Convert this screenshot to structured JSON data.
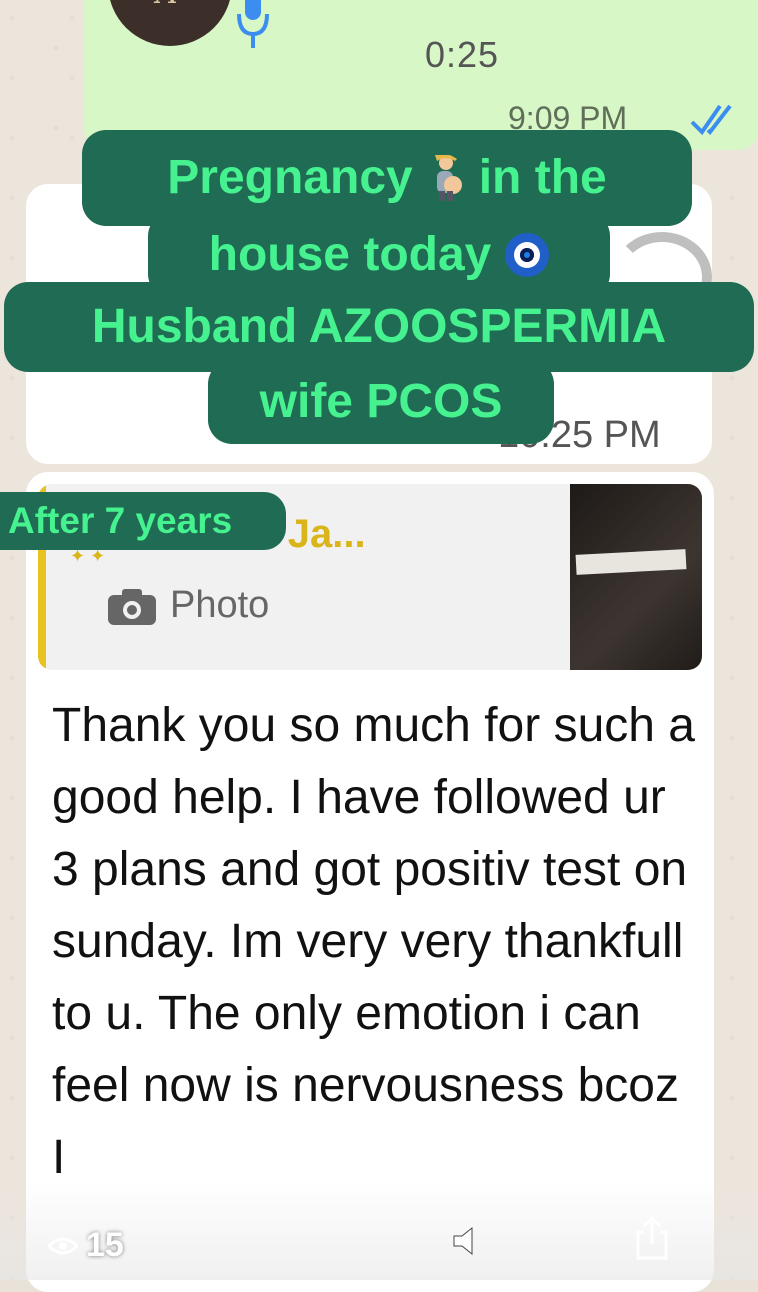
{
  "voice_message": {
    "duration": "0:25",
    "time": "9:09 PM",
    "read_status": "read"
  },
  "hidden_message": {
    "time": "10:25 PM"
  },
  "overlay": {
    "line1_a": "Pregnancy",
    "line1_b": "in the",
    "line2": "house today",
    "line3": "Husband AZOOSPERMIA",
    "line4": "wife PCOS",
    "badge": "After 7 years"
  },
  "reply": {
    "author": "Amina Fmf Ja...",
    "type_label": "Photo"
  },
  "message": {
    "text": "Thank you so much for such a good help. I have followed ur 3 plans and got positiv test on sunday. Im very very thankfull to u. The only emotion i can feel now is nervousness bcoz I"
  },
  "story_bar": {
    "view_count": "15"
  },
  "colors": {
    "overlay_bg": "#1f6b53",
    "overlay_text": "#46f28f",
    "outgoing_bubble": "#d8f7c6",
    "reply_author": "#d9b51a"
  },
  "icons": [
    "microphone-icon",
    "double-check-icon",
    "camera-icon",
    "eye-icon",
    "mute-icon",
    "share-icon",
    "pregnant-person-emoji",
    "nazar-amulet-emoji"
  ]
}
